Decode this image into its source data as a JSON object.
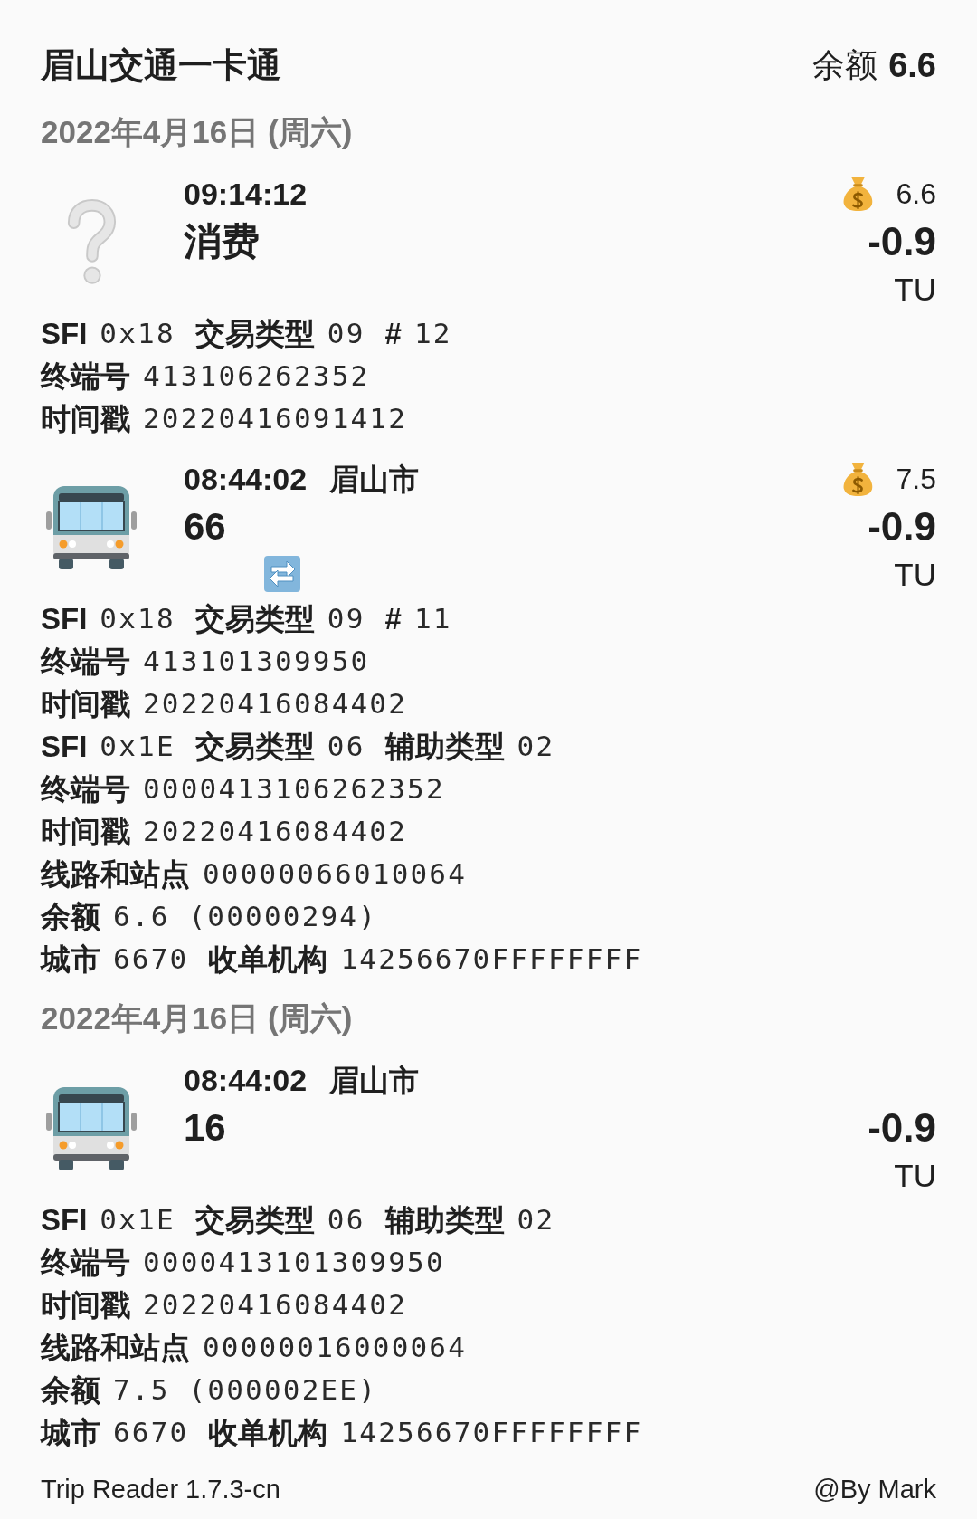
{
  "header": {
    "title": "眉山交通一卡通",
    "balance_label": "余额",
    "balance": "6.6"
  },
  "groups": [
    {
      "date": "2022年4月16日 (周六)",
      "trips": [
        {
          "kind": "unknown",
          "time": "09:14:12",
          "title": "消费",
          "transfer": false,
          "balance": "6.6",
          "amount": "-0.9",
          "currency": "TU",
          "details": [
            {
              "fields": [
                {
                  "label": "SFI",
                  "value": "0x18"
                },
                {
                  "label": "交易类型",
                  "value": "09"
                },
                {
                  "label": "#",
                  "value": "12"
                }
              ]
            },
            {
              "fields": [
                {
                  "label": "终端号",
                  "value": "413106262352"
                }
              ]
            },
            {
              "fields": [
                {
                  "label": "时间戳",
                  "value": "20220416091412"
                }
              ]
            }
          ]
        },
        {
          "kind": "bus",
          "time": "08:44:02",
          "city": "眉山市",
          "title": "66",
          "transfer": true,
          "balance": "7.5",
          "amount": "-0.9",
          "currency": "TU",
          "details": [
            {
              "fields": [
                {
                  "label": "SFI",
                  "value": "0x18"
                },
                {
                  "label": "交易类型",
                  "value": "09"
                },
                {
                  "label": "#",
                  "value": "11"
                }
              ]
            },
            {
              "fields": [
                {
                  "label": "终端号",
                  "value": "413101309950"
                }
              ]
            },
            {
              "fields": [
                {
                  "label": "时间戳",
                  "value": "20220416084402"
                }
              ]
            },
            {
              "fields": [
                {
                  "label": "SFI",
                  "value": "0x1E"
                },
                {
                  "label": "交易类型",
                  "value": "06"
                },
                {
                  "label": "辅助类型",
                  "value": "02"
                }
              ]
            },
            {
              "fields": [
                {
                  "label": "终端号",
                  "value": "0000413106262352"
                }
              ]
            },
            {
              "fields": [
                {
                  "label": "时间戳",
                  "value": "20220416084402"
                }
              ]
            },
            {
              "fields": [
                {
                  "label": "线路和站点",
                  "value": "00000066010064"
                }
              ]
            },
            {
              "fields": [
                {
                  "label": "余额",
                  "value": "6.6 (00000294)"
                }
              ]
            },
            {
              "fields": [
                {
                  "label": "城市",
                  "value": "6670"
                },
                {
                  "label": "收单机构",
                  "value": "14256670FFFFFFFF"
                }
              ]
            }
          ]
        }
      ]
    },
    {
      "date": "2022年4月16日 (周六)",
      "trips": [
        {
          "kind": "bus",
          "time": "08:44:02",
          "city": "眉山市",
          "title": "16",
          "transfer": false,
          "amount": "-0.9",
          "currency": "TU",
          "details": [
            {
              "fields": [
                {
                  "label": "SFI",
                  "value": "0x1E"
                },
                {
                  "label": "交易类型",
                  "value": "06"
                },
                {
                  "label": "辅助类型",
                  "value": "02"
                }
              ]
            },
            {
              "fields": [
                {
                  "label": "终端号",
                  "value": "0000413101309950"
                }
              ]
            },
            {
              "fields": [
                {
                  "label": "时间戳",
                  "value": "20220416084402"
                }
              ]
            },
            {
              "fields": [
                {
                  "label": "线路和站点",
                  "value": "00000016000064"
                }
              ]
            },
            {
              "fields": [
                {
                  "label": "余额",
                  "value": "7.5 (000002EE)"
                }
              ]
            },
            {
              "fields": [
                {
                  "label": "城市",
                  "value": "6670"
                },
                {
                  "label": "收单机构",
                  "value": "14256670FFFFFFFF"
                }
              ]
            }
          ]
        }
      ]
    }
  ],
  "footer": {
    "app_version": "Trip Reader 1.7.3-cn",
    "author": "@By Mark"
  }
}
